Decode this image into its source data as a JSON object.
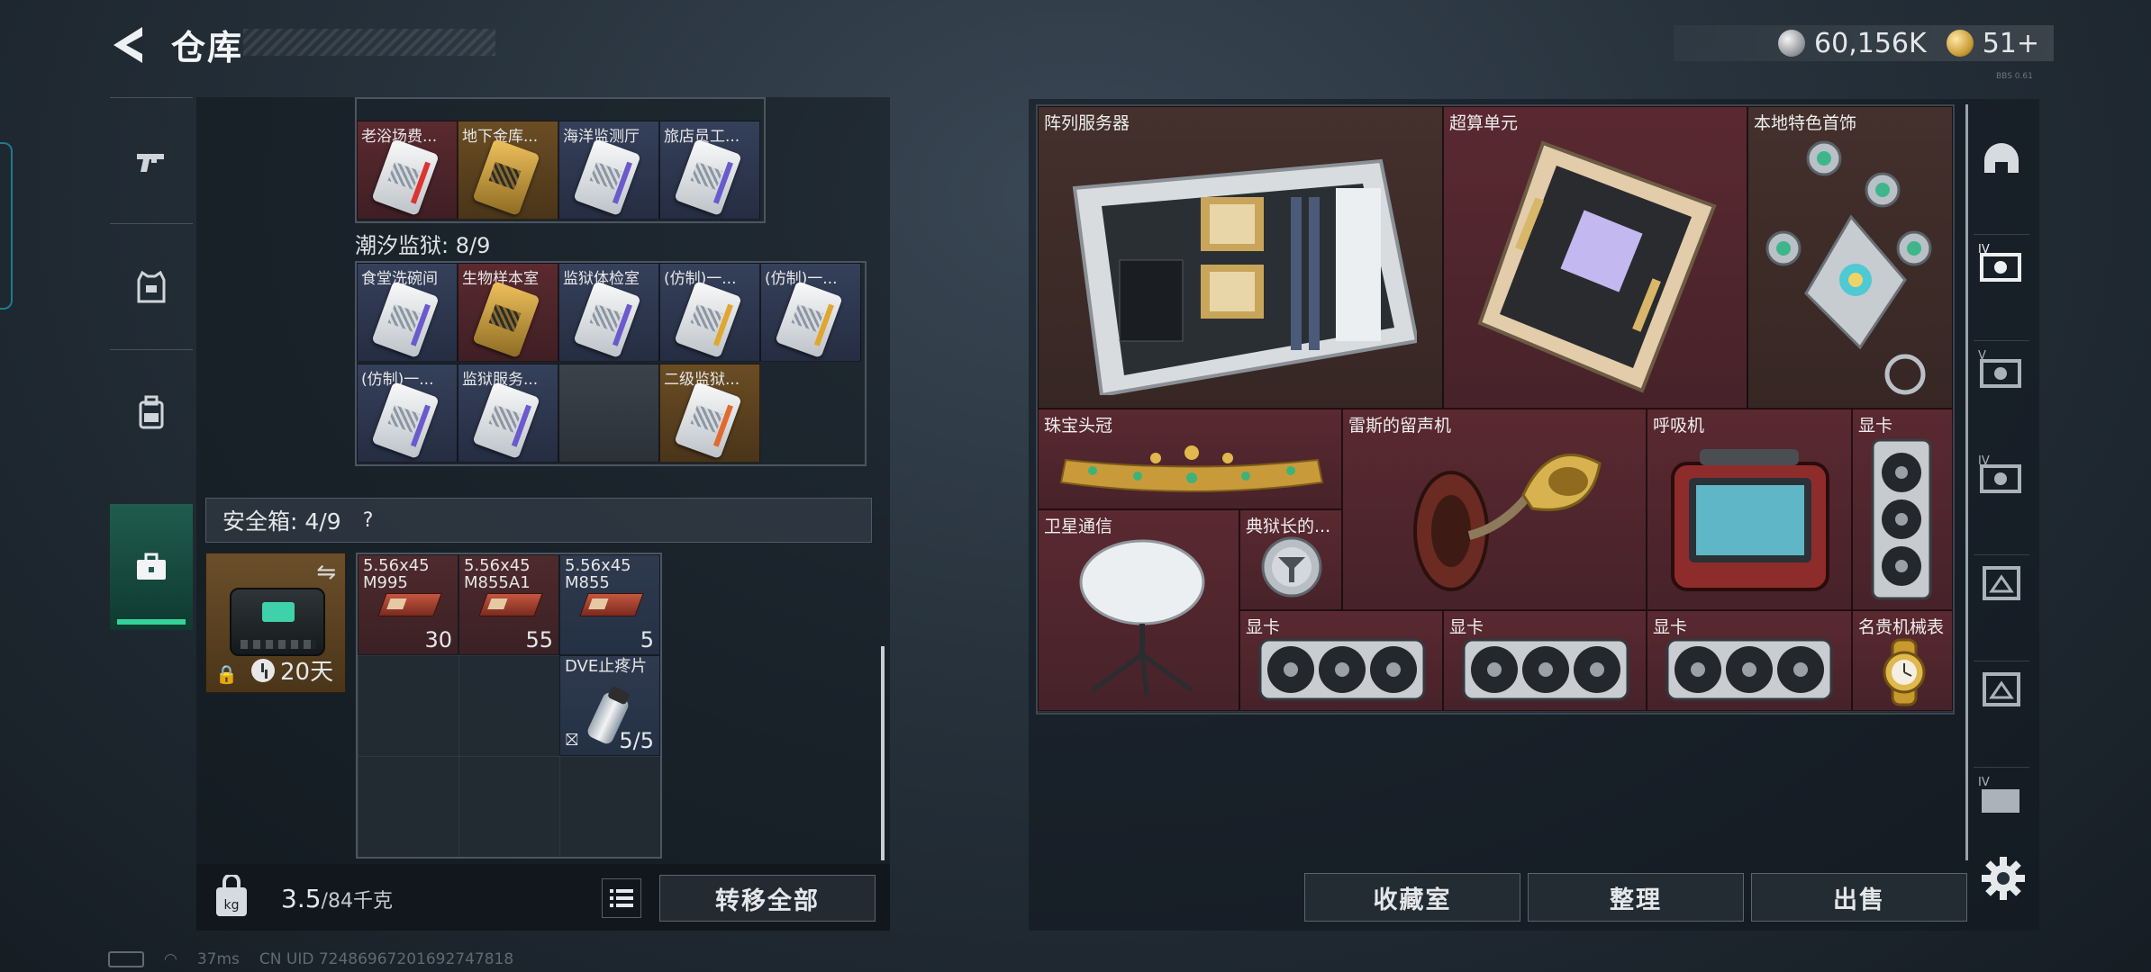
{
  "header": {
    "title": "仓库",
    "currency": [
      {
        "icon": "silver-coin-icon",
        "value": "60,156K"
      },
      {
        "icon": "gold-coin-icon",
        "value": "51+"
      }
    ],
    "tiny_note": "BBS 0.61"
  },
  "left_nav": [
    {
      "name": "weapon",
      "icon": "pistol-icon"
    },
    {
      "name": "armor",
      "icon": "vest-icon"
    },
    {
      "name": "backpack",
      "icon": "backpack-icon"
    },
    {
      "name": "case",
      "icon": "briefcase-icon",
      "active": true
    }
  ],
  "key_section_top": {
    "cards": [
      {
        "label": "老浴场费...",
        "color": "red",
        "card": "white"
      },
      {
        "label": "地下金库...",
        "color": "gold",
        "card": "gold"
      },
      {
        "label": "海洋监测厅",
        "color": "blue",
        "card": "white"
      },
      {
        "label": "旅店员工...",
        "color": "blue",
        "card": "white"
      }
    ]
  },
  "prison_section": {
    "title": "潮汐监狱: 8/9",
    "cards": [
      {
        "label": "食堂洗碗间",
        "color": "blue",
        "card": "white"
      },
      {
        "label": "生物样本室",
        "color": "red",
        "card": "gold"
      },
      {
        "label": "监狱体检室",
        "color": "blue",
        "card": "white"
      },
      {
        "label": "(仿制)一...",
        "color": "blue",
        "card": "white"
      },
      {
        "label": "(仿制)一...",
        "color": "blue",
        "card": "white"
      },
      {
        "label": "(仿制)一...",
        "color": "blue",
        "card": "white"
      },
      {
        "label": "监狱服务...",
        "color": "blue",
        "card": "white"
      },
      {
        "label": "",
        "color": "grey",
        "card": ""
      },
      {
        "label": "二级监狱...",
        "color": "gold",
        "card": "white"
      }
    ]
  },
  "safebox": {
    "label": "安全箱: 4/9",
    "help": "?",
    "days": "20天",
    "items": [
      {
        "label": "5.56x45\nM995",
        "count": "30",
        "color": "red"
      },
      {
        "label": "5.56x45\nM855A1",
        "count": "55",
        "color": "red"
      },
      {
        "label": "5.56x45\nM855",
        "count": "5",
        "color": "blue"
      },
      {
        "label": "DVE止疼片",
        "count": "5/5",
        "color": "blue"
      }
    ]
  },
  "bottom": {
    "weight_value": "3.5",
    "weight_max": "/84千克",
    "transfer_all": "转移全部"
  },
  "stash_items": [
    {
      "label": "阵列服务器",
      "color": "brown",
      "art": "server-art"
    },
    {
      "label": "超算单元",
      "color": "maroon",
      "art": "mainboard-art"
    },
    {
      "label": "本地特色首饰",
      "color": "brown",
      "art": "jewelry-art"
    },
    {
      "label": "珠宝头冠",
      "color": "maroon",
      "art": "crown-art"
    },
    {
      "label": "雷斯的留声机",
      "color": "maroon",
      "art": "gramophone-art"
    },
    {
      "label": "呼吸机",
      "color": "maroon",
      "art": "ventilator-art"
    },
    {
      "label": "显卡",
      "color": "maroon",
      "art": "gpu-vertical-art"
    },
    {
      "label": "卫星通信",
      "color": "maroon",
      "art": "satellite-art"
    },
    {
      "label": "典狱长的...",
      "color": "maroon",
      "art": "badge-art"
    },
    {
      "label": "显卡",
      "color": "maroon",
      "art": "gpu-art"
    },
    {
      "label": "显卡",
      "color": "maroon",
      "art": "gpu-art"
    },
    {
      "label": "显卡",
      "color": "maroon",
      "art": "gpu-art"
    },
    {
      "label": "名贵机械表",
      "color": "maroon",
      "art": "watch-art"
    }
  ],
  "right_tabs": [
    "helmet-tab-icon",
    "tier4-case-icon",
    "tier5-case-icon",
    "tier4-case-icon-2",
    "map-case-icon",
    "map-case-icon-2",
    "tier4-box-icon"
  ],
  "actions": {
    "collection": "收藏室",
    "sort": "整理",
    "sell": "出售"
  },
  "status": {
    "ping": "37ms",
    "uid": "CN UID 7248696720169274781​8"
  },
  "colors": {
    "accent_green": "#35d39b",
    "maroon": "#5a2930",
    "gold": "#c79a35"
  }
}
